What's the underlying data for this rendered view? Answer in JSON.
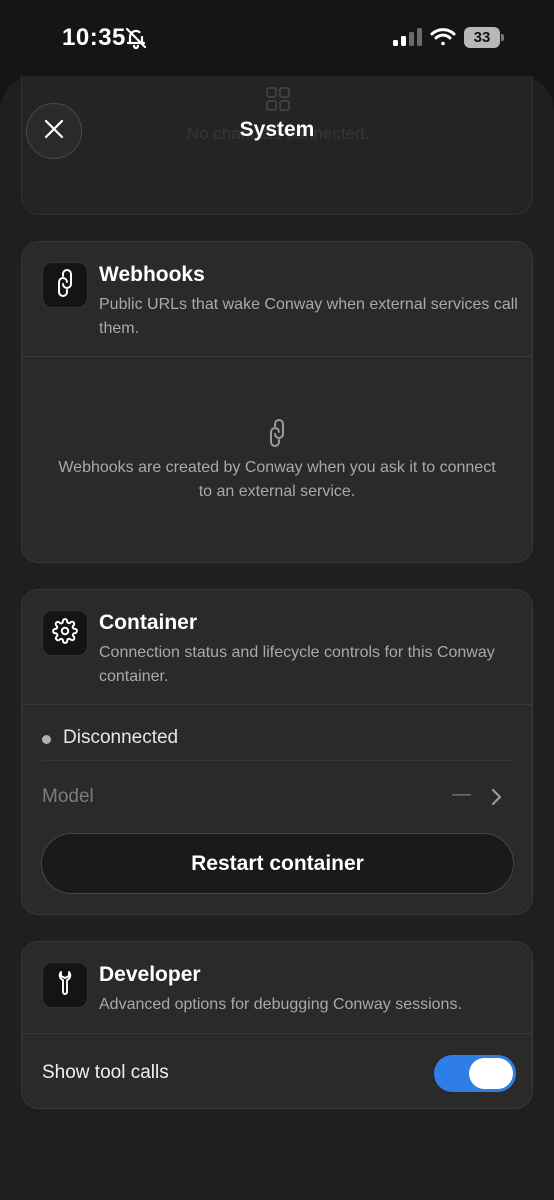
{
  "statusbar": {
    "time": "10:35",
    "battery": "33"
  },
  "sheet": {
    "title": "System",
    "faded_text": "No channels connected."
  },
  "webhooks": {
    "title": "Webhooks",
    "description": "Public URLs that wake Conway when external services call them.",
    "empty_text": "Webhooks are created by Conway when you ask it to connect to an external service."
  },
  "container": {
    "title": "Container",
    "description": "Connection status and lifecycle controls for this Conway container.",
    "status": "Disconnected",
    "model_label": "Model",
    "model_value": "—",
    "restart_label": "Restart container"
  },
  "developer": {
    "title": "Developer",
    "description": "Advanced options for debugging Conway sessions.",
    "toggle_label": "Show tool calls",
    "toggle_on": true
  },
  "colors": {
    "accent": "#2f7ee8",
    "background": "#1f1f1f",
    "card": "#2a2a2a"
  },
  "icons": [
    "bell-slash-icon",
    "signal-icon",
    "wifi-icon",
    "battery-icon",
    "close-icon",
    "link-icon",
    "gear-icon",
    "wrench-icon",
    "chevron-right-icon"
  ]
}
